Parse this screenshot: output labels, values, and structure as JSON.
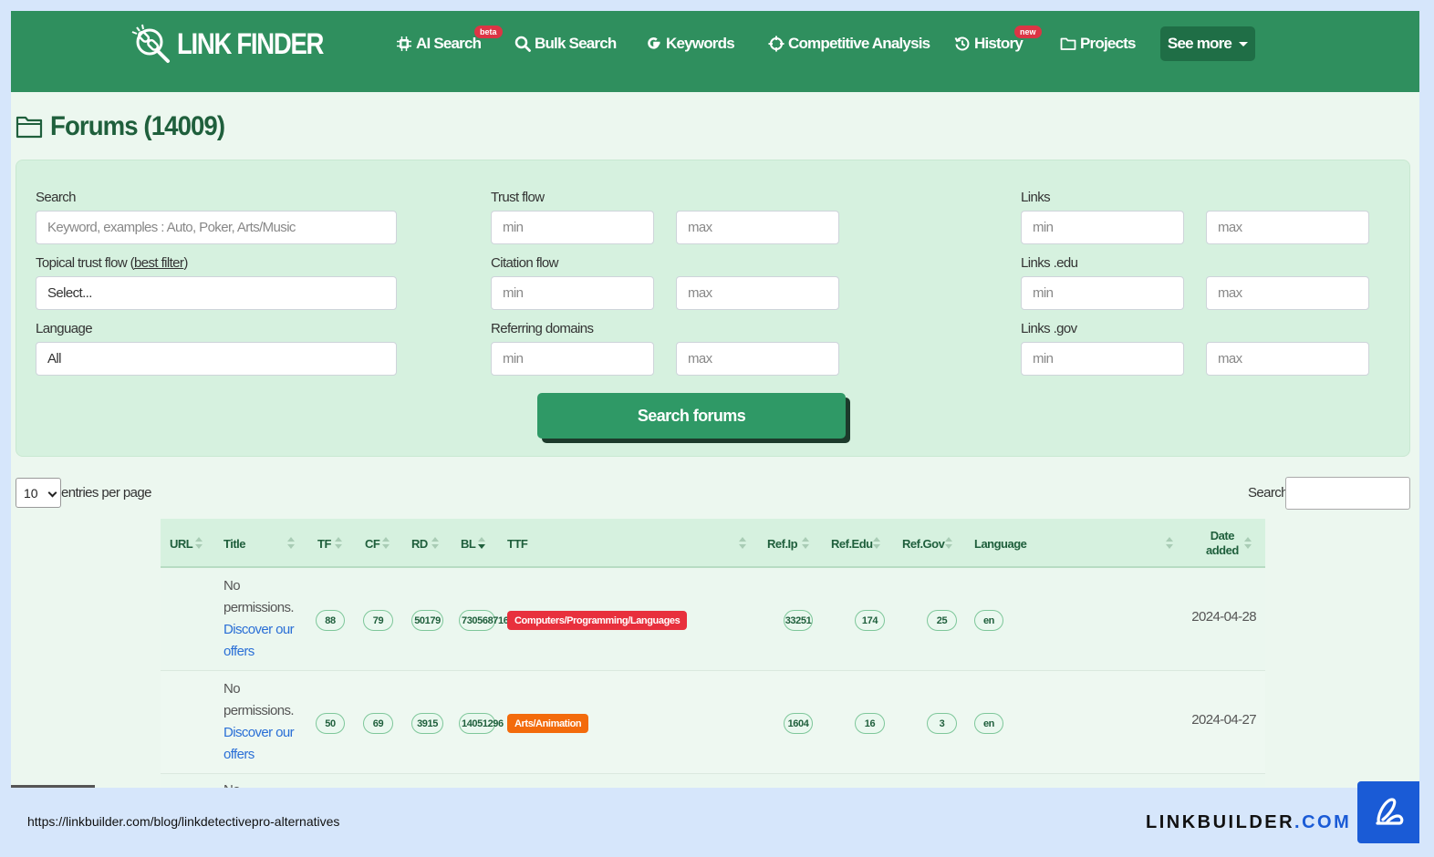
{
  "app": {
    "logo_text": "LINK FINDER"
  },
  "nav": {
    "items": [
      {
        "label": "AI Search",
        "badge": "beta"
      },
      {
        "label": "Bulk Search"
      },
      {
        "label": "Keywords"
      },
      {
        "label": "Competitive Analysis"
      },
      {
        "label": "History",
        "badge": "new"
      },
      {
        "label": "Projects"
      }
    ],
    "see_more": "See more"
  },
  "page": {
    "title": "Forums (14009)"
  },
  "filters": {
    "search_label": "Search",
    "search_placeholder": "Keyword, examples : Auto, Poker, Arts/Music",
    "ttf_label": "Topical trust flow (",
    "ttf_link": "best filter",
    "ttf_close": ")",
    "ttf_value": "Select...",
    "language_label": "Language",
    "language_value": "All",
    "trust_flow_label": "Trust flow",
    "citation_flow_label": "Citation flow",
    "referring_domains_label": "Referring domains",
    "links_label": "Links",
    "links_edu_label": "Links .edu",
    "links_gov_label": "Links .gov",
    "min": "min",
    "max": "max",
    "submit": "Search forums"
  },
  "table_controls": {
    "page_length": "10",
    "page_length_label": "entries per page",
    "search_label": "Search:"
  },
  "table": {
    "columns": [
      "URL",
      "Title",
      "TF",
      "CF",
      "RD",
      "BL",
      "TTF",
      "Ref.Ip",
      "Ref.Edu",
      "Ref.Gov",
      "Language",
      "Date",
      "added"
    ],
    "rows": [
      {
        "title_text": "No permissions.",
        "title_link": "Discover our offers",
        "tf": "88",
        "cf": "79",
        "rd": "50179",
        "bl": "730568716",
        "ttf": "Computers/Programming/Languages",
        "ttf_color": "#e8303d",
        "ref_ip": "33251",
        "ref_edu": "174",
        "ref_gov": "25",
        "language": "en",
        "date": "2024-04-28"
      },
      {
        "title_text": "No permissions.",
        "title_link": "Discover our offers",
        "tf": "50",
        "cf": "69",
        "rd": "3915",
        "bl": "14051296",
        "ttf": "Arts/Animation",
        "ttf_color": "#f36b0c",
        "ref_ip": "1604",
        "ref_edu": "16",
        "ref_gov": "3",
        "language": "en",
        "date": "2024-04-27"
      }
    ],
    "partial_row_text": "No"
  },
  "footer": {
    "url": "https://linkbuilder.com/blog/linkdetectivepro-alternatives",
    "brand_main": "LINKBUILDER",
    "brand_dot": ".",
    "brand_tld": "COM"
  },
  "colors": {
    "primary": "#2f8f5e",
    "dark": "#1f6e46",
    "badge": "#dc3545",
    "brand_blue": "#1a5bd6"
  }
}
